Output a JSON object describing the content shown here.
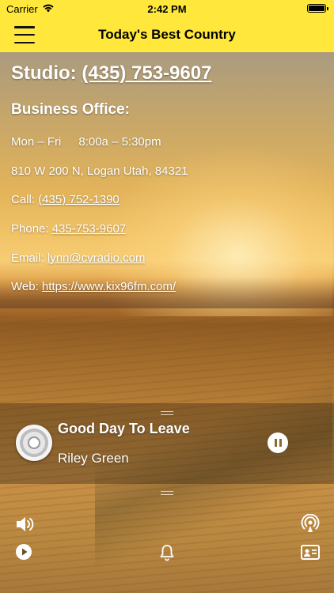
{
  "status_bar": {
    "carrier": "Carrier",
    "time": "2:42 PM"
  },
  "nav": {
    "title": "Today's Best Country",
    "menu_icon": "hamburger-menu-icon"
  },
  "contact": {
    "studio_label": "Studio:",
    "studio_phone": "(435) 753-9607",
    "business_heading": "Business Office:",
    "hours_days": "Mon – Fri",
    "hours_time": "8:00a – 5:30pm",
    "address": "810 W 200 N, Logan Utah, 84321",
    "call_label": "Call:",
    "call_phone": "(435) 752-1390",
    "phone_label": "Phone:",
    "phone_number": "435-753-9607",
    "email_label": "Email:",
    "email": "lynn@cvradio.com",
    "web_label": "Web:",
    "web_url": "https://www.kix96fm.com/"
  },
  "player": {
    "song_title": "Good Day To Leave",
    "artist": "Riley Green",
    "state_icon": "pause-icon"
  },
  "toolbar": {
    "icons": [
      "volume-icon",
      "podcast-icon",
      "play-circle-icon",
      "bell-icon",
      "contact-card-icon"
    ]
  },
  "colors": {
    "accent_yellow": "#ffe83b",
    "text_white": "#ffffff"
  }
}
